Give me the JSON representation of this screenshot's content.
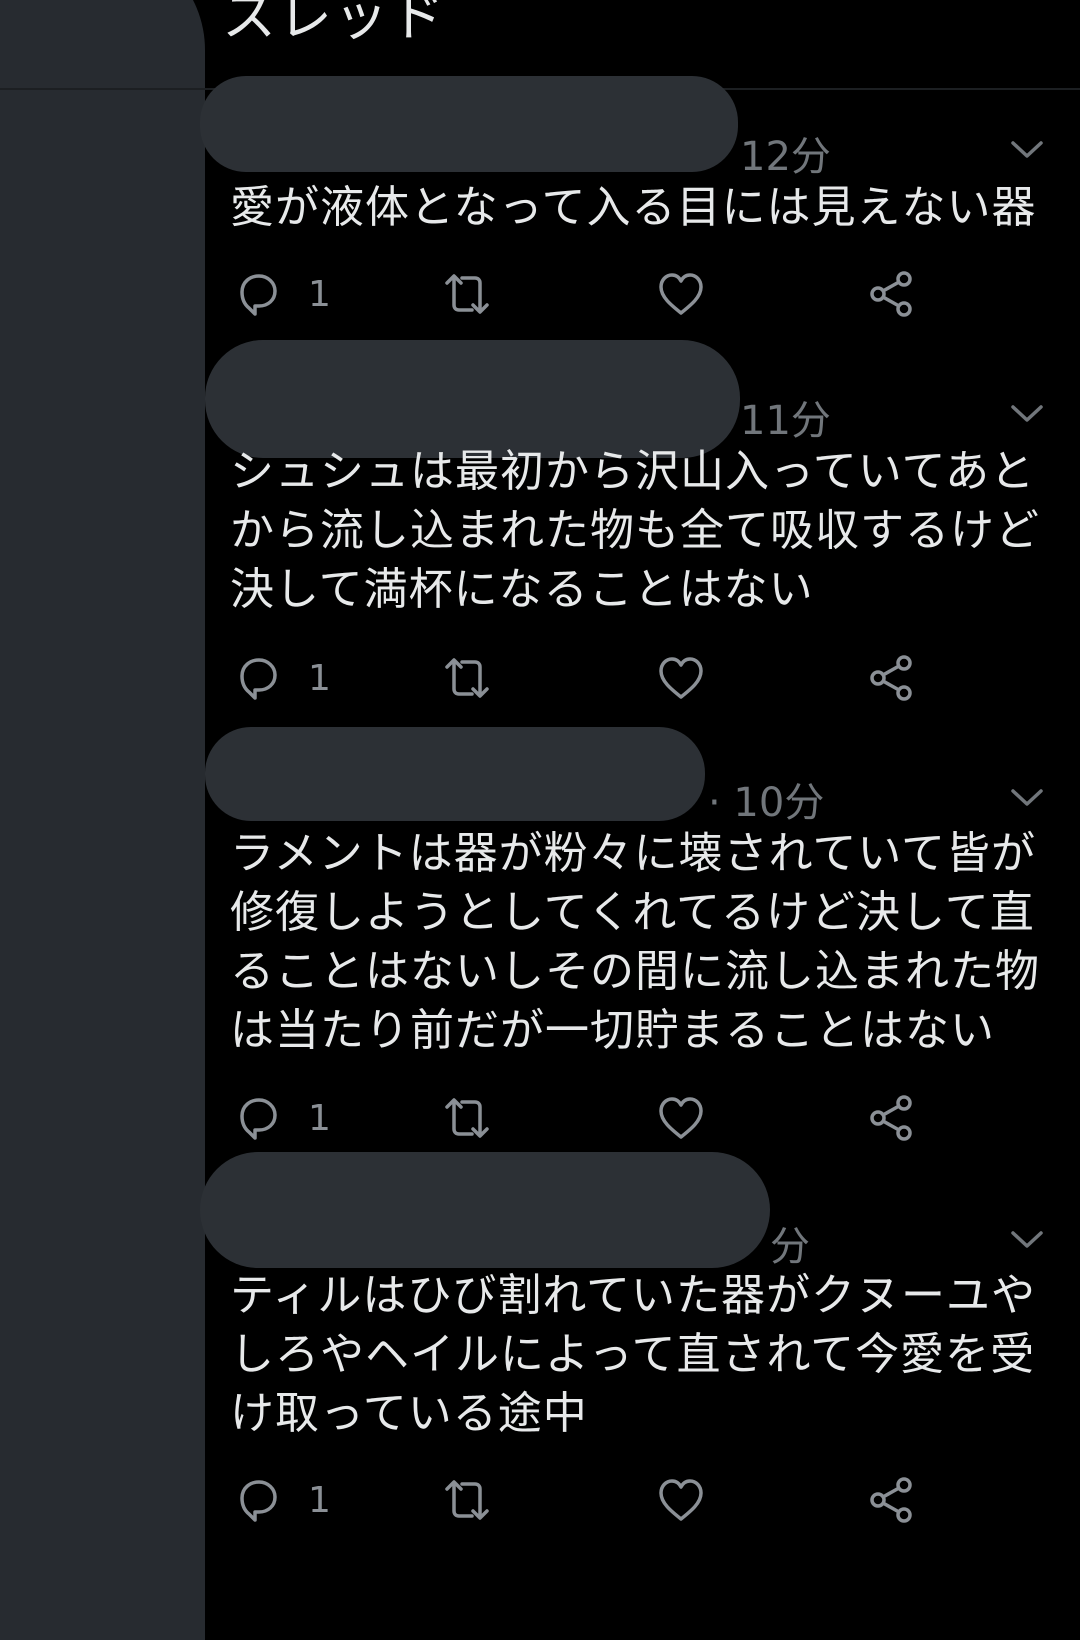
{
  "header": {
    "title": "スレッド"
  },
  "tweets": [
    {
      "time": "12分",
      "text": "愛が液体となって入る目には見えない器",
      "reply_count": "1"
    },
    {
      "time": "11分",
      "text": "シュシュは最初から沢山入っていてあとから流し込まれた物も全て吸収するけど決して満杯になることはない",
      "reply_count": "1"
    },
    {
      "time": "· 10分",
      "text": "ラメントは器が粉々に壊されていて皆が修復しようとしてくれてるけど決して直ることはないしその間に流し込まれた物は当たり前だが一切貯まることはない",
      "reply_count": "1"
    },
    {
      "time": "分",
      "text": "ティルはひび割れていた器がクヌーユやしろやヘイルによって直されて今愛を受け取っている途中",
      "reply_count": "1"
    }
  ],
  "icons": {
    "reply": "reply-icon",
    "retweet": "retweet-icon",
    "like": "heart-icon",
    "share": "share-icon",
    "more": "chevron-down-icon"
  },
  "colors": {
    "background": "#000000",
    "text": "#e7e9ea",
    "secondary": "#71767b",
    "redaction": "#272b30"
  }
}
